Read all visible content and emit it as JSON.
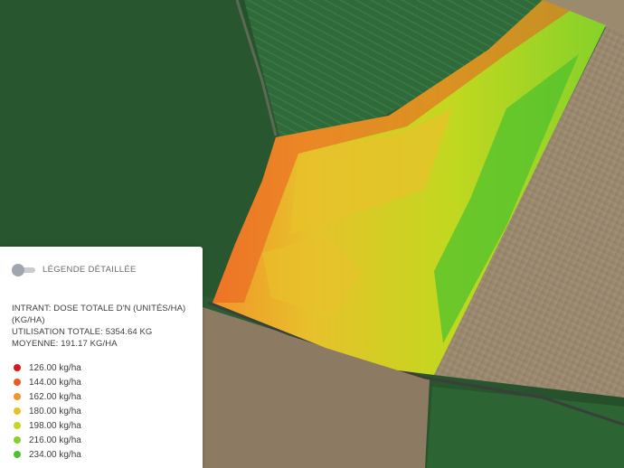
{
  "legend": {
    "toggle_label": "LÉGENDE DÉTAILLÉE",
    "intrant_line1": "INTRANT: DOSE TOTALE D'N (UNITÉS/HA)",
    "intrant_line2": "(KG/HA)",
    "total_usage": "UTILISATION TOTALE: 5354.64 KG",
    "average": "MOYENNE: 191.17 KG/HA",
    "classes": [
      {
        "label": "126.00 kg/ha",
        "color": "#d7191c"
      },
      {
        "label": "144.00 kg/ha",
        "color": "#ec5a23"
      },
      {
        "label": "162.00 kg/ha",
        "color": "#f0962a"
      },
      {
        "label": "180.00 kg/ha",
        "color": "#e7c12b"
      },
      {
        "label": "198.00 kg/ha",
        "color": "#c3d81f"
      },
      {
        "label": "216.00 kg/ha",
        "color": "#86d12a"
      },
      {
        "label": "234.00 kg/ha",
        "color": "#4fc12e"
      }
    ]
  }
}
